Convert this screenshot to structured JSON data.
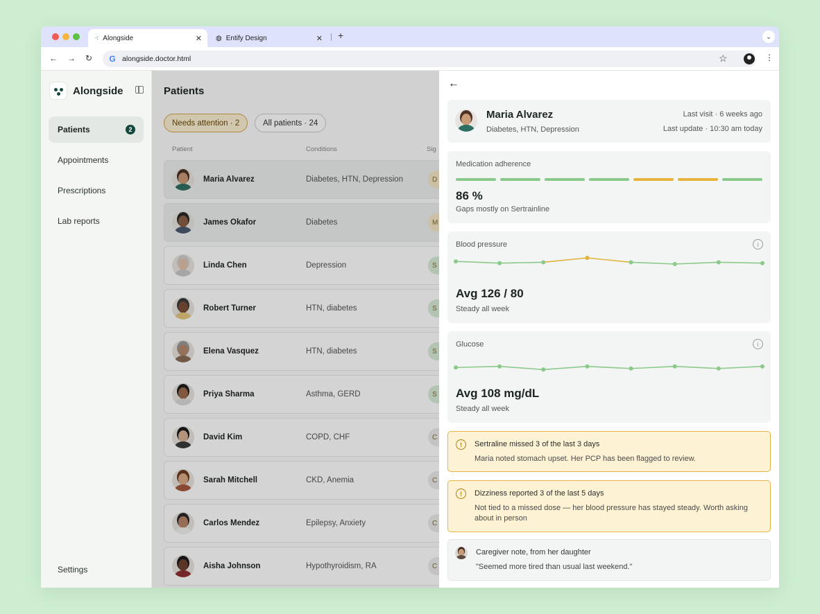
{
  "browser": {
    "tabs": [
      {
        "title": "Alongside",
        "active": true
      },
      {
        "title": "Entify Design",
        "active": false
      }
    ],
    "url": "alongside.doctor.html"
  },
  "sidebar": {
    "brand": "Alongside",
    "items": [
      {
        "label": "Patients",
        "badge": "2",
        "active": true
      },
      {
        "label": "Appointments"
      },
      {
        "label": "Prescriptions"
      },
      {
        "label": "Lab reports"
      }
    ],
    "settings": "Settings"
  },
  "patients": {
    "title": "Patients",
    "filters": {
      "attention": "Needs attention · 2",
      "all": "All patients · 24"
    },
    "columns": {
      "patient": "Patient",
      "conditions": "Conditions",
      "signal": "Sig"
    },
    "rows": [
      {
        "name": "Maria Alvarez",
        "conditions": "Diabetes, HTN, Depression",
        "sig": "D",
        "sig_color": "#f5e7c4",
        "skin": "#c99a78",
        "shirt": "#2f6f63",
        "hair": "#4a3124"
      },
      {
        "name": "James Okafor",
        "conditions": "Diabetes",
        "sig": "M",
        "sig_color": "#f5e7c4",
        "skin": "#8b5e44",
        "shirt": "#4a5a70",
        "hair": "#2a2a2a"
      },
      {
        "name": "Linda Chen",
        "conditions": "Depression",
        "sig": "S",
        "sig_color": "#d8ecd6",
        "skin": "#e0c2aa",
        "shirt": "#c8c8c8",
        "hair": "#cfcfcf"
      },
      {
        "name": "Robert Turner",
        "conditions": "HTN, diabetes",
        "sig": "S",
        "sig_color": "#d8ecd6",
        "skin": "#7b5038",
        "shirt": "#e4c77e",
        "hair": "#3a3a3a"
      },
      {
        "name": "Elena Vasquez",
        "conditions": "HTN, diabetes",
        "sig": "S",
        "sig_color": "#d8ecd6",
        "skin": "#b58a6e",
        "shirt": "#8a6b55",
        "hair": "#9a9a9a"
      },
      {
        "name": "Priya Sharma",
        "conditions": "Asthma, GERD",
        "sig": "S",
        "sig_color": "#d8ecd6",
        "skin": "#9b6a4c",
        "shirt": "#d9d9d9",
        "hair": "#1d1d1d"
      },
      {
        "name": "David Kim",
        "conditions": "COPD, CHF",
        "sig": "C",
        "sig_color": "#ebebeb",
        "skin": "#d8b294",
        "shirt": "#3a3a3a",
        "hair": "#1a1a1a"
      },
      {
        "name": "Sarah Mitchell",
        "conditions": "CKD, Anemia",
        "sig": "C",
        "sig_color": "#ebebeb",
        "skin": "#d9a987",
        "shirt": "#a45a3e",
        "hair": "#6a3a22"
      },
      {
        "name": "Carlos Mendez",
        "conditions": "Epilepsy, Anxiety",
        "sig": "C",
        "sig_color": "#ebebeb",
        "skin": "#b68566",
        "shirt": "#f0f0f0",
        "hair": "#2b2b2b"
      },
      {
        "name": "Aisha Johnson",
        "conditions": "Hypothyroidism, RA",
        "sig": "C",
        "sig_color": "#ebebeb",
        "skin": "#6e4230",
        "shirt": "#8e2e2e",
        "hair": "#1a1a1a"
      }
    ]
  },
  "detail": {
    "name": "Maria Alvarez",
    "conditions": "Diabetes, HTN, Depression",
    "last_visit": "Last visit · 6 weeks ago",
    "last_update": "Last update · 10:30 am today",
    "adherence": {
      "label": "Medication adherence",
      "value": "86 %",
      "note": "Gaps mostly on Sertrainline",
      "segments": [
        "taken",
        "taken",
        "taken",
        "taken",
        "missed",
        "missed",
        "taken"
      ],
      "colors": {
        "taken": "#8bc98a",
        "missed": "#e6b43c"
      }
    },
    "bp": {
      "label": "Blood pressure",
      "avg": "Avg 126 / 80",
      "note": "Steady all week",
      "points": [
        128,
        126,
        127,
        132,
        127,
        125,
        127,
        126
      ],
      "flag_index": 3
    },
    "glucose": {
      "label": "Glucose",
      "avg": "Avg 108 mg/dL",
      "note": "Steady all week",
      "points": [
        108,
        109,
        106,
        109,
        107,
        109,
        107,
        109
      ]
    },
    "alerts": [
      {
        "title": "Sertraline missed 3 of the last 3 days",
        "body": "Maria noted stomach upset. Her PCP has been flagged to review."
      },
      {
        "title": "Dizziness reported 3 of the last 5 days",
        "body": "Not tied to a missed dose — her blood pressure has stayed steady. Worth asking about in person"
      }
    ],
    "caregiver": {
      "title": "Caregiver note, from her daughter",
      "quote": "\"Seemed more tired than usual last weekend.\""
    }
  }
}
